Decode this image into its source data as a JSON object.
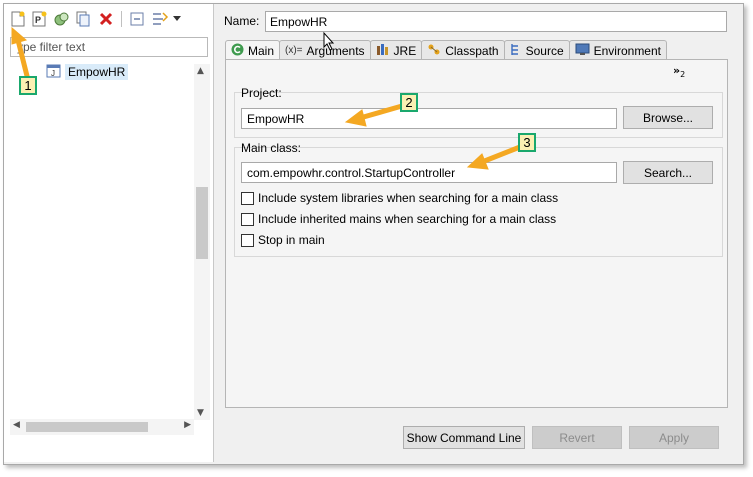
{
  "toolbar": {
    "icons": [
      "new-launch-config-icon",
      "new-prototype-icon",
      "duplicate-icon",
      "copy-icon",
      "delete-icon",
      "collapse-all-icon",
      "filter-icon",
      "dropdown-icon"
    ]
  },
  "left": {
    "filter_placeholder": "type filter text",
    "filter_visible": "ype filter text",
    "tree_items": [
      {
        "label": "EmpowHR",
        "icon": "java-app-icon"
      }
    ]
  },
  "right": {
    "name_label": "Name:",
    "name_value": "EmpowHR",
    "tabs": [
      {
        "label": "Main",
        "icon": "main-tab-icon",
        "active": true
      },
      {
        "label": "Arguments",
        "icon": "arguments-icon"
      },
      {
        "label": "JRE",
        "icon": "jre-icon"
      },
      {
        "label": "Classpath",
        "icon": "classpath-icon"
      },
      {
        "label": "Source",
        "icon": "source-icon"
      },
      {
        "label": "Environment",
        "icon": "environment-icon"
      }
    ],
    "overflow_count": "2",
    "overflow_glyph": "»",
    "project": {
      "label": "Project:",
      "value": "EmpowHR",
      "browse_label": "Browse..."
    },
    "main_class": {
      "label": "Main class:",
      "value": "com.empowhr.control.StartupController",
      "search_label": "Search..."
    },
    "checkboxes": [
      {
        "label": "Include system libraries when searching for a main class",
        "checked": false
      },
      {
        "label": "Include inherited mains when searching for a main class",
        "checked": false
      },
      {
        "label": "Stop in main",
        "checked": false
      }
    ],
    "buttons": {
      "show_command_line": "Show Command Line",
      "revert": "Revert",
      "apply": "Apply"
    }
  },
  "annotations": [
    {
      "number": "1"
    },
    {
      "number": "2"
    },
    {
      "number": "3"
    }
  ],
  "colors": {
    "callout_border": "#1aa86d",
    "callout_fill": "#fbf0b3",
    "arrow": "#f4a822",
    "tree_selection": "#d9ebf9"
  }
}
